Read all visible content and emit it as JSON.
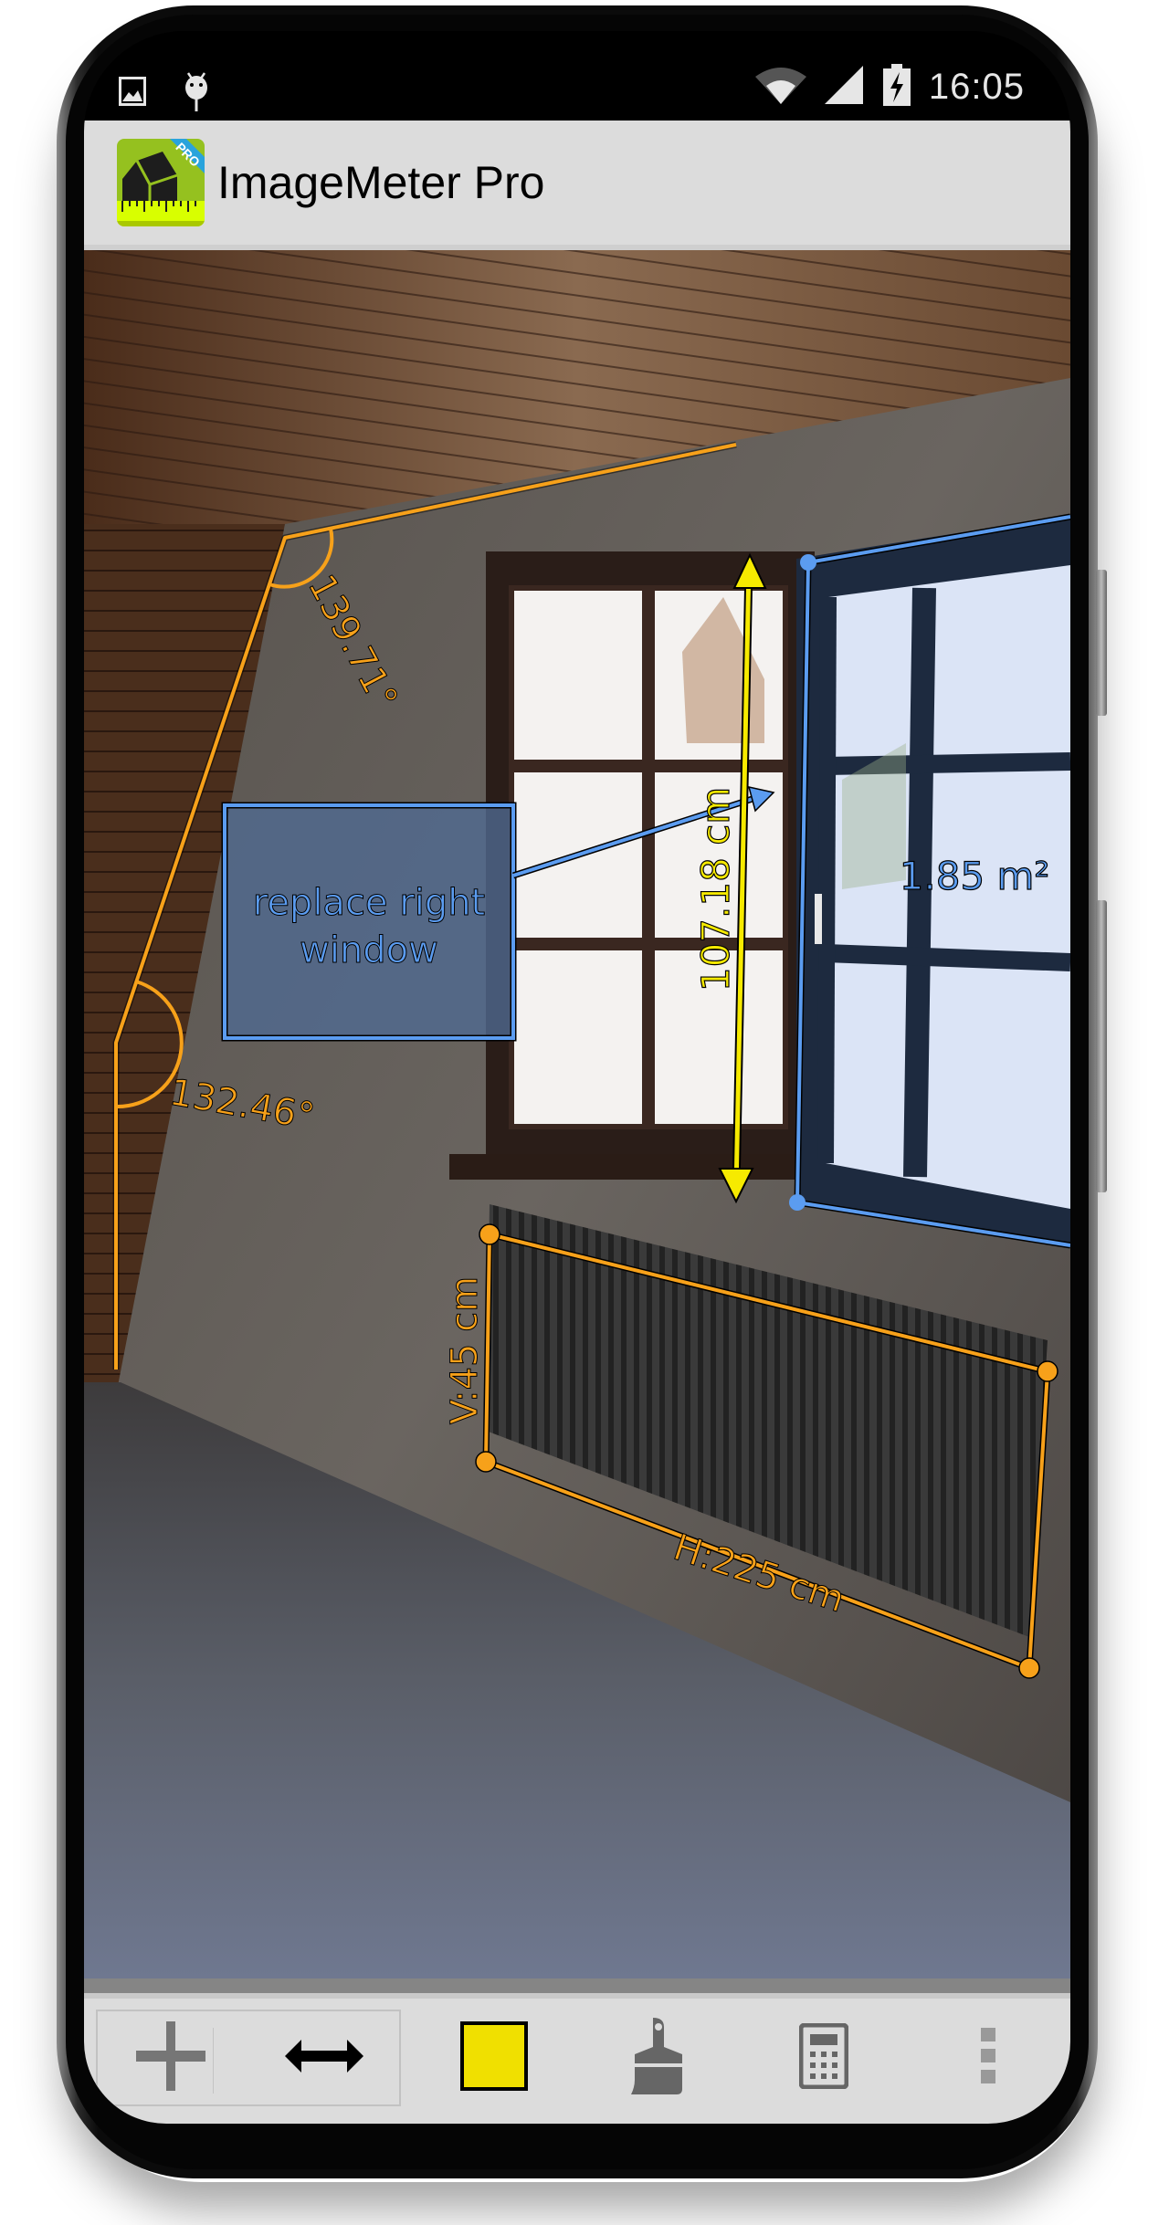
{
  "status_bar": {
    "left_icons": [
      "image-notification-icon",
      "android-debug-icon"
    ],
    "right_icons": [
      "wifi-icon",
      "cell-signal-icon",
      "battery-charging-icon"
    ],
    "time": "16:05"
  },
  "app_bar": {
    "app_icon": "imagemeter-pro-logo-icon",
    "icon_badge": "PRO",
    "title": "ImageMeter Pro"
  },
  "annotations": {
    "angle_top": "139.71°",
    "angle_bottom": "132.46°",
    "note_text_line1": "replace right",
    "note_text_line2": "window",
    "height_measure": "107.18 cm",
    "area_measure": "1.85 m²",
    "radiator_vertical": "V:45 cm",
    "radiator_horizontal": "H:225 cm",
    "colors": {
      "orange": "#f7a11a",
      "blue": "#5b9cf0",
      "yellow": "#f6ea00",
      "note_fill": "#4f6a92"
    }
  },
  "toolbar": {
    "items": [
      {
        "name": "add-point-tool",
        "icon": "plus-icon"
      },
      {
        "name": "measure-line-tool",
        "icon": "double-arrow-icon"
      },
      {
        "name": "color-picker",
        "icon": "color-swatch-icon",
        "color": "#f0e000"
      },
      {
        "name": "style-brush-tool",
        "icon": "paintbrush-icon"
      },
      {
        "name": "calculator-tool",
        "icon": "calculator-icon"
      },
      {
        "name": "overflow-menu",
        "icon": "more-vertical-icon"
      }
    ]
  }
}
